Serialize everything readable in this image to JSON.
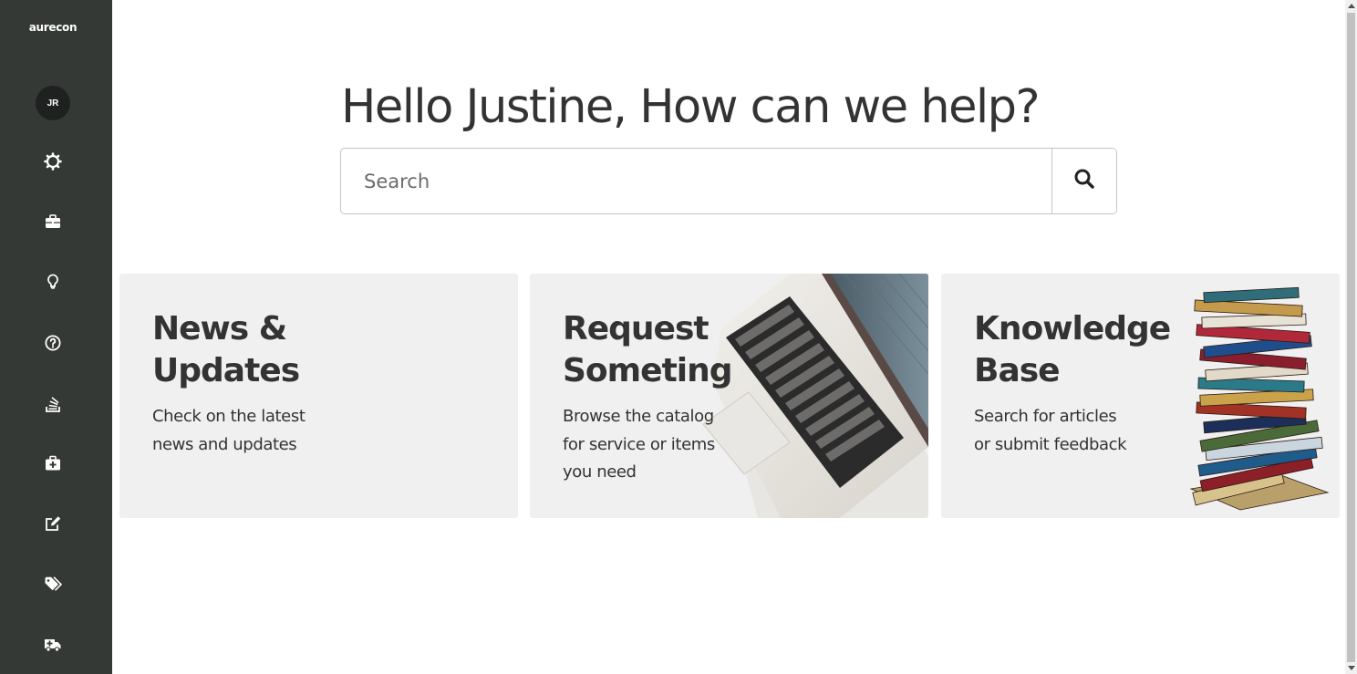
{
  "brand": {
    "logo_text": "aurecon"
  },
  "user": {
    "initials": "JR"
  },
  "sidebar": {
    "items": [
      {
        "name": "settings",
        "icon": "gear-icon"
      },
      {
        "name": "work",
        "icon": "briefcase-icon"
      },
      {
        "name": "ideas",
        "icon": "lightbulb-icon"
      },
      {
        "name": "help",
        "icon": "question-circle-icon"
      },
      {
        "name": "knowledge",
        "icon": "stack-icon"
      },
      {
        "name": "health",
        "icon": "medkit-icon"
      },
      {
        "name": "edit",
        "icon": "edit-icon"
      },
      {
        "name": "tags",
        "icon": "tags-icon"
      },
      {
        "name": "emergency",
        "icon": "ambulance-icon"
      }
    ]
  },
  "main": {
    "greeting": "Hello Justine, How can we help?",
    "search": {
      "placeholder": "Search",
      "button_icon": "search-icon"
    }
  },
  "cards": [
    {
      "title": "News & Updates",
      "description_lines": [
        "Check on the latest",
        "news and updates"
      ],
      "art": ""
    },
    {
      "title": "Request Someting",
      "description_lines": [
        "Browse the catalog",
        "for service or items",
        "you need"
      ],
      "art": "laptop-image"
    },
    {
      "title": "Knowledge Base",
      "description_lines": [
        "Search for articles",
        "or submit feedback"
      ],
      "art": "book-stack-image"
    }
  ],
  "colors": {
    "sidebar_bg": "#353935",
    "avatar_bg": "#1e2120",
    "card_bg": "#f0f0f0",
    "text": "#333333"
  }
}
